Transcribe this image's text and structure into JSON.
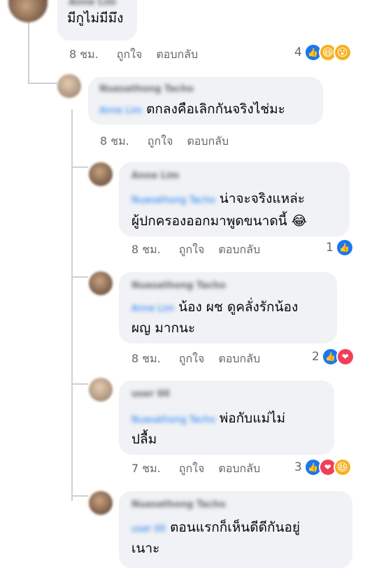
{
  "comments": [
    {
      "name": "Anne Lim",
      "tag": "",
      "lines": [
        "มีกูไม่มีมึง"
      ],
      "time": "8 ชม.",
      "like": "ถูกใจ",
      "reply": "ตอบกลับ",
      "count": "4",
      "reactions": [
        "like",
        "haha",
        "wow"
      ]
    },
    {
      "name": "Nuasathong Tacho",
      "tag": "Anne Lim",
      "lines": [
        "ตกลงคือเลิกกันจริงไช่มะ"
      ],
      "time": "8 ชม.",
      "like": "ถูกใจ",
      "reply": "ตอบกลับ",
      "count": "",
      "reactions": []
    },
    {
      "name": "Anne Lim",
      "tag": "Nuasathong Tacho",
      "lines": [
        "น่าจะจริงแหล่ะ",
        "ผู้ปกครองออกมาพูดขนาดนี้ 😂"
      ],
      "time": "8 ชม.",
      "like": "ถูกใจ",
      "reply": "ตอบกลับ",
      "count": "1",
      "reactions": [
        "like"
      ]
    },
    {
      "name": "Nuasathong Tacho",
      "tag": "Anne Lim",
      "lines": [
        "น้อง ผช ดูคลั่งรักน้อง",
        "ผญ มากนะ"
      ],
      "time": "8 ชม.",
      "like": "ถูกใจ",
      "reply": "ตอบกลับ",
      "count": "2",
      "reactions": [
        "like",
        "love"
      ]
    },
    {
      "name": "user 00",
      "tag": "Nuasathong Tacho",
      "lines": [
        "พ่อกับแม่ไม่",
        "ปลื้ม"
      ],
      "time": "7 ชม.",
      "like": "ถูกใจ",
      "reply": "ตอบกลับ",
      "count": "3",
      "reactions": [
        "like",
        "love",
        "haha"
      ]
    },
    {
      "name": "Nuasathong Tacho",
      "tag": "user 00",
      "lines": [
        "ตอนแรกก็เห็นดีดีกันอยู่",
        "เนาะ"
      ],
      "time": "",
      "like": "",
      "reply": "",
      "count": "",
      "reactions": []
    }
  ],
  "reaction_glyphs": {
    "like": "👍",
    "love": "❤",
    "haha": "😆",
    "wow": "😮"
  },
  "colors": {
    "like": "#1877f2",
    "love": "#f33e58",
    "haha": "#f7b125",
    "wow": "#f7b125",
    "bubble": "#f0f2f5",
    "meta": "#65676b"
  }
}
